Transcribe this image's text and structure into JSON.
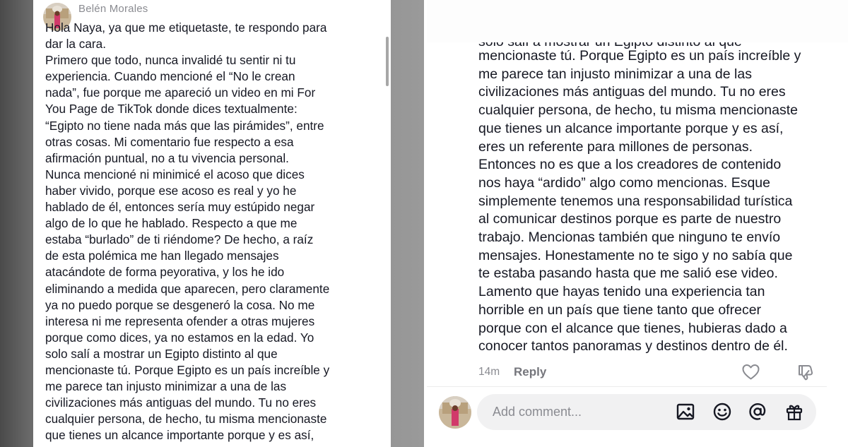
{
  "left_panel": {
    "author": "Belén Morales",
    "lines": [
      "Hola Naya, ya que me etiquetaste, te respondo para",
      "dar la cara.",
      "Primero que todo, nunca invalidé tu sentir ni tu",
      "experiencia. Cuando mencioné el “No le crean",
      "nada”, fue porque me apareció un video en mi For",
      "You Page de TikTok donde dices textualmente:",
      "“Egipto no tiene nada más que las pirámides”, entre",
      "otras cosas. Mi comentario fue respecto a esa",
      "afirmación puntual, no a tu vivencia personal.",
      "Nunca mencioné ni minimicé el acoso que dices",
      "haber vivido, porque ese acoso es real y yo he",
      "hablado de él, entonces sería muy estúpido negar",
      "algo de lo que he hablado. Respecto a que me",
      "estaba “burlado” de ti riéndome? De hecho, a raíz",
      "de esta polémica me han llegado mensajes",
      "atacándote de forma peyorativa, y los he ido",
      "eliminando a medida que aparecen, pero claramente",
      "ya no puedo porque se desgeneró la cosa. No me",
      "interesa ni me representa ofender a otras mujeres",
      "porque como dices, ya no estamos en la edad. Yo",
      "solo salí a mostrar un Egipto distinto al que",
      "mencionaste tú. Porque Egipto es un país increíble y",
      "me parece tan injusto minimizar a una de las",
      "civilizaciones más antiguas del mundo. Tu no eres",
      "cualquier persona, de hecho, tu misma mencionaste",
      "que tienes un alcance importante porque y es así,"
    ]
  },
  "right_panel": {
    "clipped_line": "solo salí a mostrar un Egipto distinto al que",
    "lines": [
      "mencionaste tú. Porque Egipto es un país increíble y",
      "me parece tan injusto minimizar a una de las",
      "civilizaciones más antiguas del mundo. Tu no eres",
      "cualquier persona, de hecho, tu misma mencionaste",
      "que tienes un alcance importante porque y es así,",
      "eres un referente para millones de personas.",
      "Entonces no es que a los creadores de contenido",
      "nos haya “ardido” algo como mencionas. Esque",
      "simplemente tenemos una responsabilidad turística",
      "al comunicar destinos porque es parte de nuestro",
      "trabajo. Mencionas también que ninguno te envío",
      "mensajes. Honestamente no te sigo y no sabía que",
      "te estaba pasando hasta que me salió ese video.",
      "Lamento que hayas tenido una experiencia tan",
      "horrible en un país que tiene tanto que ofrecer",
      "porque con el alcance que tienes, hubieras dado a",
      "conocer tantos panoramas y destinos dentro de él."
    ],
    "time": "14m",
    "reply_label": "Reply",
    "comment_placeholder": "Add comment...",
    "icons": [
      "heart-icon",
      "dislike-icon",
      "image-icon",
      "emoji-icon",
      "mention-icon",
      "gift-icon"
    ]
  },
  "colors": {
    "text": "#161823",
    "muted": "#8a8b91",
    "input_bg": "#f1f1f2"
  }
}
